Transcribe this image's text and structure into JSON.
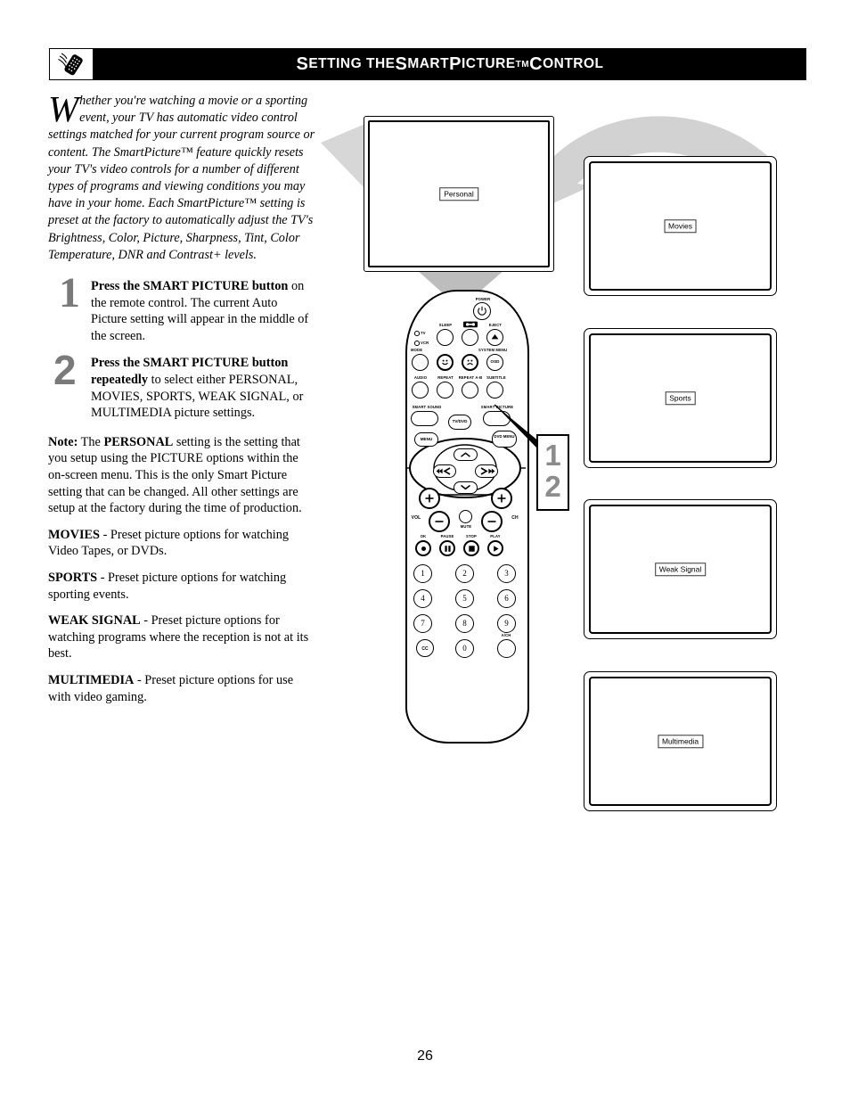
{
  "header": {
    "icon": "remote-control-icon",
    "title_parts": [
      "S",
      "ETTING THE ",
      "S",
      "MART",
      "P",
      "ICTURE",
      "TM",
      " C",
      "ONTROL"
    ],
    "title_full": "SETTING THE SMARTPICTURE™ CONTROL"
  },
  "intro": {
    "dropcap": "W",
    "text": "hether you're watching a movie or a sporting event, your TV has automatic video control settings matched for your current program source or content. The SmartPicture™ feature quickly resets your TV's video controls for a number of different types of programs and viewing conditions you may have in your home. Each SmartPicture™ setting is preset at the factory to automatically adjust the TV's Brightness, Color, Picture, Sharpness, Tint, Color Temperature, DNR and Contrast+ levels."
  },
  "steps": [
    {
      "number": "1",
      "bold_lead": "Press the SMART PICTURE button",
      "rest": " on the remote control. The current Auto Picture setting will appear in the middle of the screen."
    },
    {
      "number": "2",
      "bold_lead": "Press the SMART PICTURE button repeatedly",
      "rest": " to select either PERSONAL, MOVIES, SPORTS, WEAK SIGNAL, or MULTIMEDIA  picture settings."
    }
  ],
  "notes": [
    {
      "lead": "Note:",
      "lead2": "PERSONAL",
      "text": " setting is the setting that you setup using the PICTURE options within the on-screen menu. This is the only Smart Picture setting that can be changed. All other settings are setup at the factory during the time of production.",
      "mid": " The "
    },
    {
      "lead": "MOVIES",
      "text": " - Preset picture options for watching Video Tapes, or DVDs."
    },
    {
      "lead": "SPORTS",
      "text": " - Preset picture options for watching sporting events."
    },
    {
      "lead": "WEAK SIGNAL",
      "text": " - Preset picture options for watching programs where the reception is not at its best."
    },
    {
      "lead": "MULTIMEDIA",
      "text": " - Preset picture options for use with video gaming."
    }
  ],
  "diagram": {
    "tv_main_osd": "Personal",
    "screens": [
      {
        "name": "movies",
        "osd": "Movies"
      },
      {
        "name": "sports",
        "osd": "Sports"
      },
      {
        "name": "weak",
        "osd": "Weak Signal"
      },
      {
        "name": "multimedia",
        "osd": "Multimedia"
      }
    ],
    "callout": {
      "line1": "1",
      "line2": "2",
      "color": "#8c8c8c"
    },
    "arrow_color": "#c9c9c9"
  },
  "remote": {
    "labels": {
      "power": "POWER",
      "sleep": "SLEEP",
      "eject": "EJECT",
      "tv": "TV",
      "vcr": "VCR",
      "mode": "MODE",
      "system_menu": "SYSTEM MENU",
      "osd": "OSD",
      "audio": "AUDIO",
      "repeat": "REPEAT",
      "repeat_ab": "REPEAT A-B",
      "subtitle": "SUBTITLE",
      "smart_sound": "SMART SOUND",
      "smart_picture": "SMART PICTURE",
      "tv_dvd": "TV/DVD",
      "menu": "MENU",
      "dvd_menu": "DVD MENU",
      "vol": "VOL",
      "ch": "CH",
      "mute": "MUTE",
      "ok": "OK",
      "pause": "PAUSE",
      "stop": "STOP",
      "play": "PLAY",
      "ach": "A/CH",
      "cc": "CC"
    },
    "keypad": [
      "1",
      "2",
      "3",
      "4",
      "5",
      "6",
      "7",
      "8",
      "9",
      "CC",
      "0",
      ""
    ]
  },
  "page_number": "26"
}
